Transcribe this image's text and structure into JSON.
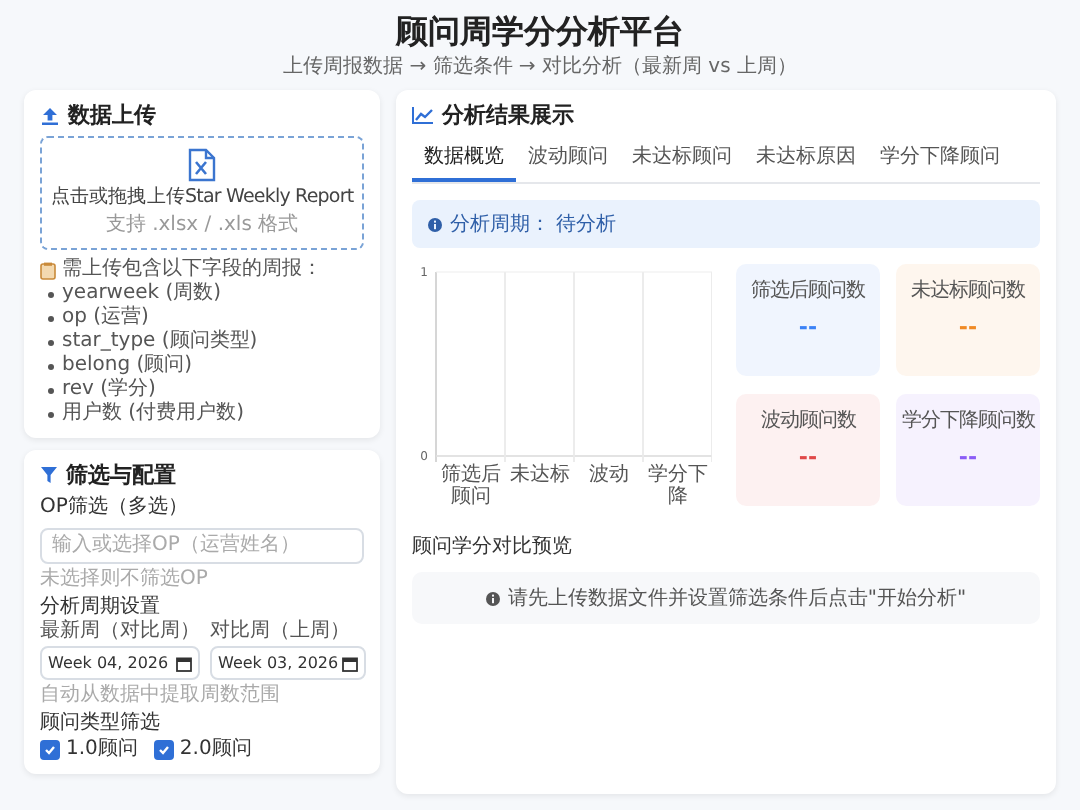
{
  "header": {
    "title": "顾问周学分分析平台",
    "subtitle": "上传周报数据 → 筛选条件 → 对比分析（最新周 vs 上周）"
  },
  "upload": {
    "title": "数据上传",
    "drop_text": "点击或拖拽上传Star Weekly Report",
    "drop_hint": "支持 .xlsx / .xls 格式",
    "fields_title": "需上传包含以下字段的周报：",
    "fields": [
      "yearweek (周数)",
      "op (运营)",
      "star_type (顾问类型)",
      "belong (顾问)",
      "rev (学分)",
      "用户数 (付费用户数)"
    ]
  },
  "filters": {
    "title": "筛选与配置",
    "op_label": "OP筛选（多选）",
    "op_placeholder": "输入或选择OP（运营姓名）",
    "op_hint": "未选择则不筛选OP",
    "period_label": "分析周期设置",
    "latest_label": "最新周（对比周）",
    "latest_value": "Week 04, 2026",
    "previous_label": "对比周（上周）",
    "previous_value": "Week 03, 2026",
    "period_hint": "自动从数据中提取周数范围",
    "type_label": "顾问类型筛选",
    "types": [
      {
        "label": "1.0顾问",
        "checked": true
      },
      {
        "label": "2.0顾问",
        "checked": true
      }
    ]
  },
  "results": {
    "title": "分析结果展示",
    "tabs": [
      {
        "label": "数据概览",
        "selected": true
      },
      {
        "label": "波动顾问",
        "selected": false
      },
      {
        "label": "未达标顾问",
        "selected": false
      },
      {
        "label": "未达标原因",
        "selected": false
      },
      {
        "label": "学分下降顾问",
        "selected": false
      }
    ],
    "period_label": "分析周期：",
    "period_value": "待分析",
    "chart_data": {
      "type": "bar",
      "categories": [
        "筛选后顾问",
        "未达标",
        "波动",
        "学分下降"
      ],
      "values": [
        null,
        null,
        null,
        null
      ],
      "ylim": [
        0,
        1
      ],
      "yticks": [
        0,
        1
      ]
    },
    "stats": [
      {
        "label": "筛选后顾问数",
        "value": "--",
        "color": "#3b82f6"
      },
      {
        "label": "未达标顾问数",
        "value": "--",
        "color": "#f08a24"
      },
      {
        "label": "波动顾问数",
        "value": "--",
        "color": "#e04848"
      },
      {
        "label": "学分下降顾问数",
        "value": "--",
        "color": "#8b5cf6"
      }
    ],
    "preview_title": "顾问学分对比预览",
    "preview_message": "请先上传数据文件并设置筛选条件后点击\"开始分析\""
  }
}
